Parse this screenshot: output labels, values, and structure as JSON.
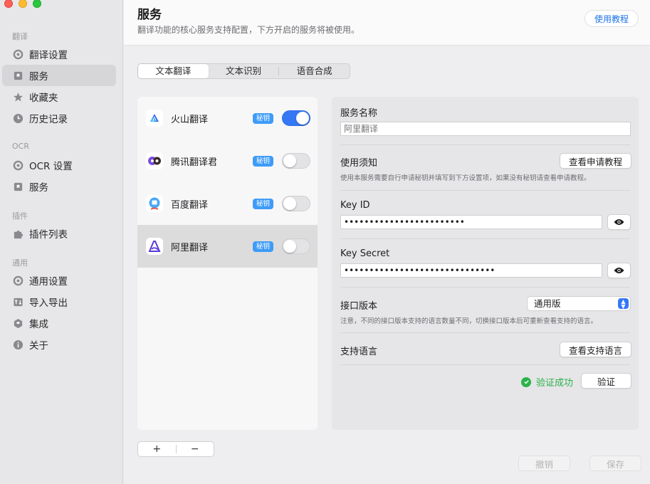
{
  "sidebar": {
    "sections": [
      {
        "title": "翻译",
        "items": [
          {
            "label": "翻译设置",
            "icon": "gear-icon"
          },
          {
            "label": "服务",
            "icon": "bookmark-icon",
            "active": true
          },
          {
            "label": "收藏夹",
            "icon": "star-icon"
          },
          {
            "label": "历史记录",
            "icon": "clock-icon"
          }
        ]
      },
      {
        "title": "OCR",
        "items": [
          {
            "label": "OCR 设置",
            "icon": "gear-icon"
          },
          {
            "label": "服务",
            "icon": "bookmark-icon"
          }
        ]
      },
      {
        "title": "插件",
        "items": [
          {
            "label": "插件列表",
            "icon": "puzzle-icon"
          }
        ]
      },
      {
        "title": "通用",
        "items": [
          {
            "label": "通用设置",
            "icon": "gear-icon"
          },
          {
            "label": "导入导出",
            "icon": "import-export-icon"
          },
          {
            "label": "集成",
            "icon": "integration-icon"
          },
          {
            "label": "关于",
            "icon": "info-icon"
          }
        ]
      }
    ]
  },
  "header": {
    "title": "服务",
    "subtitle": "翻译功能的核心服务支持配置，下方开启的服务将被使用。",
    "help_label": "使用教程"
  },
  "tabs": [
    {
      "label": "文本翻译",
      "active": true
    },
    {
      "label": "文本识别",
      "active": false
    },
    {
      "label": "语音合成",
      "active": false
    }
  ],
  "services": [
    {
      "name": "火山翻译",
      "badge": "秘钥",
      "enabled": true,
      "selected": false
    },
    {
      "name": "腾讯翻译君",
      "badge": "秘钥",
      "enabled": false,
      "selected": false
    },
    {
      "name": "百度翻译",
      "badge": "秘钥",
      "enabled": false,
      "selected": false
    },
    {
      "name": "阿里翻译",
      "badge": "秘钥",
      "enabled": false,
      "selected": true
    }
  ],
  "list_controls": {
    "add": "+",
    "remove": "−"
  },
  "detail": {
    "service_name_label": "服务名称",
    "service_name_placeholder": "阿里翻译",
    "notice_label": "使用须知",
    "notice_button": "查看申请教程",
    "notice_hint": "使用本服务需要自行申请秘钥并填写到下方设置项，如果没有秘钥请查看申请教程。",
    "key_id_label": "Key ID",
    "key_id_value": "••••••••••••••••••••••••",
    "key_secret_label": "Key Secret",
    "key_secret_value": "••••••••••••••••••••••••••••••",
    "api_version_label": "接口版本",
    "api_version_value": "通用版",
    "api_version_hint": "注意，不同的接口版本支持的语言数量不同，切换接口版本后可重新查看支持的语言。",
    "languages_label": "支持语言",
    "languages_button": "查看支持语言",
    "verify_status": "验证成功",
    "verify_button": "验证"
  },
  "footer": {
    "cancel": "撤销",
    "save": "保存"
  },
  "colors": {
    "accent": "#3478f6",
    "badge": "#3e9cf7",
    "success": "#2bb24c"
  }
}
